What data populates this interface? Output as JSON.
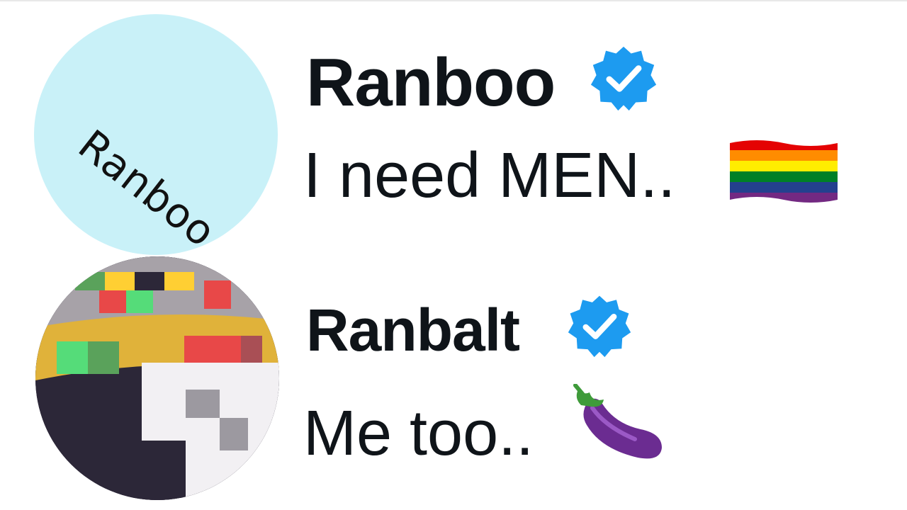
{
  "posts": [
    {
      "avatar_text": "Ranboo",
      "name": "Ranboo",
      "verified_icon": "verified-badge-icon",
      "text": "I need MEN..",
      "emoji": "rainbow-flag-icon"
    },
    {
      "avatar_icon": "pixel-crown-face-icon",
      "name": "Ranbalt",
      "verified_icon": "verified-badge-icon",
      "text": "Me too..",
      "emoji": "eggplant-icon"
    }
  ],
  "colors": {
    "verified": "#1d9bf0",
    "name": "#0f1419",
    "avatar_bg": "#c9f1f8"
  }
}
